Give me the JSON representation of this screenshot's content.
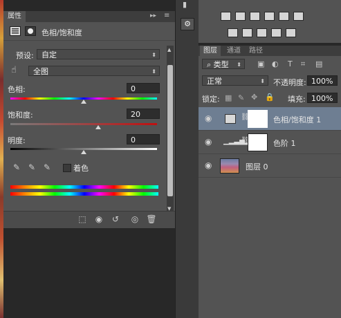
{
  "properties": {
    "tab_label": "属性",
    "adjustment_title": "色相/饱和度",
    "preset_label": "预设:",
    "preset_value": "自定",
    "channel_value": "全图",
    "hue_label": "色相:",
    "hue_value": "0",
    "saturation_label": "饱和度:",
    "saturation_value": "20",
    "lightness_label": "明度:",
    "lightness_value": "0",
    "colorize_label": "着色"
  },
  "layers": {
    "tabs": [
      "图层",
      "通道",
      "路径"
    ],
    "filter_kind": "类型",
    "blend_mode": "正常",
    "opacity_label": "不透明度:",
    "opacity_value": "100%",
    "lock_label": "锁定:",
    "fill_label": "填充:",
    "fill_value": "100%",
    "items": [
      {
        "name": "色相/饱和度 1",
        "selected": true
      },
      {
        "name": "色阶 1",
        "selected": false
      },
      {
        "name": "图层 0",
        "selected": false
      }
    ]
  },
  "colors": {
    "panel_bg": "#535353",
    "selected_row": "#6e7e92"
  }
}
